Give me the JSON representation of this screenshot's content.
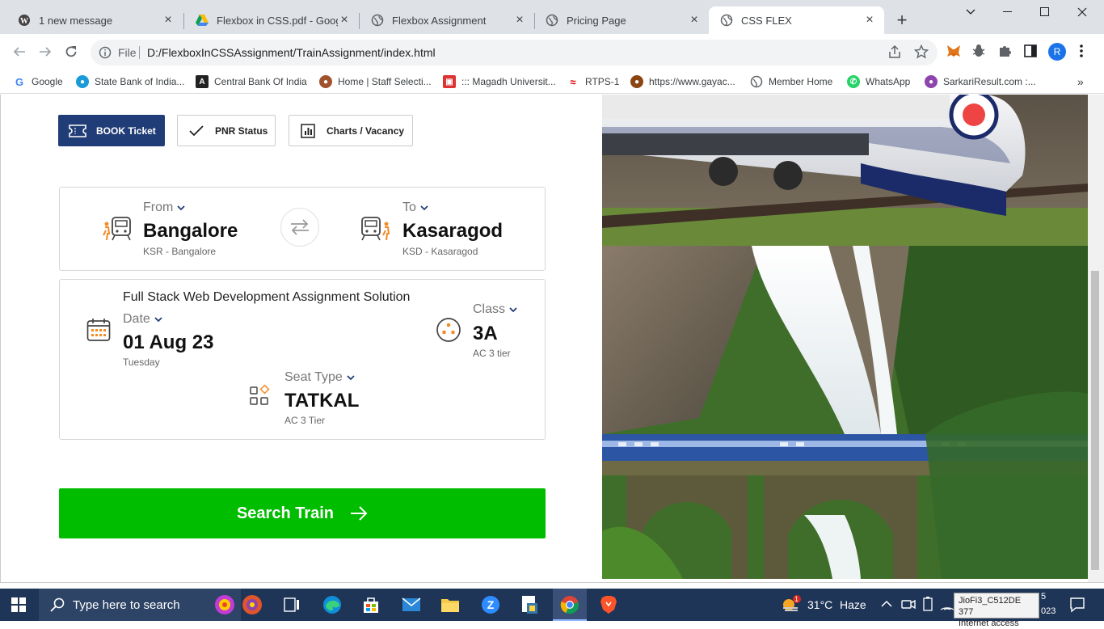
{
  "tabs": [
    {
      "title": "1 new message",
      "icon": "wordpress-icon"
    },
    {
      "title": "Flexbox in CSS.pdf - Google",
      "icon": "google-drive-icon"
    },
    {
      "title": "Flexbox Assignment",
      "icon": "globe-icon"
    },
    {
      "title": "Pricing Page",
      "icon": "globe-icon"
    },
    {
      "title": "CSS FLEX",
      "icon": "globe-icon",
      "active": true
    }
  ],
  "address": {
    "protocol": "File",
    "url": "D:/FlexboxInCSSAssignment/TrainAssignment/index.html"
  },
  "profile": {
    "initial": "R"
  },
  "bookmarks": [
    {
      "label": "Google"
    },
    {
      "label": "State Bank of India..."
    },
    {
      "label": "Central Bank Of India"
    },
    {
      "label": "Home | Staff Selecti..."
    },
    {
      "label": "::: Magadh Universit..."
    },
    {
      "label": "RTPS-1"
    },
    {
      "label": "https://www.gayac..."
    },
    {
      "label": "Member Home"
    },
    {
      "label": "WhatsApp"
    },
    {
      "label": "SarkariResult.com :..."
    }
  ],
  "booking": {
    "tabs": {
      "book": "BOOK Ticket",
      "pnr": "PNR Status",
      "charts": "Charts / Vacancy"
    },
    "from": {
      "label": "From",
      "city": "Bangalore",
      "code": "KSR - Bangalore"
    },
    "to": {
      "label": "To",
      "city": "Kasaragod",
      "code": "KSD - Kasaragod"
    },
    "heading": "Full Stack Web Development Assignment Solution",
    "date": {
      "label": "Date",
      "value": "01 Aug 23",
      "day": "Tuesday"
    },
    "class": {
      "label": "Class",
      "value": "3A",
      "sub": "AC 3 tier"
    },
    "seat": {
      "label": "Seat Type",
      "value": "TATKAL",
      "sub": "AC 3 Tier"
    },
    "search_label": "Search Train"
  },
  "taskbar": {
    "search_placeholder": "Type here to search",
    "weather": {
      "temp": "31°C",
      "condition": "Haze",
      "badge": "1"
    },
    "tooltip": {
      "line1": "JioFi3_C512DE 377",
      "line2": "Internet access"
    },
    "clock_partial": {
      "line1": "5",
      "line2": "023"
    }
  },
  "colors": {
    "primary": "#213d77",
    "search": "#01bd00",
    "accent_orange": "#f28c28"
  }
}
